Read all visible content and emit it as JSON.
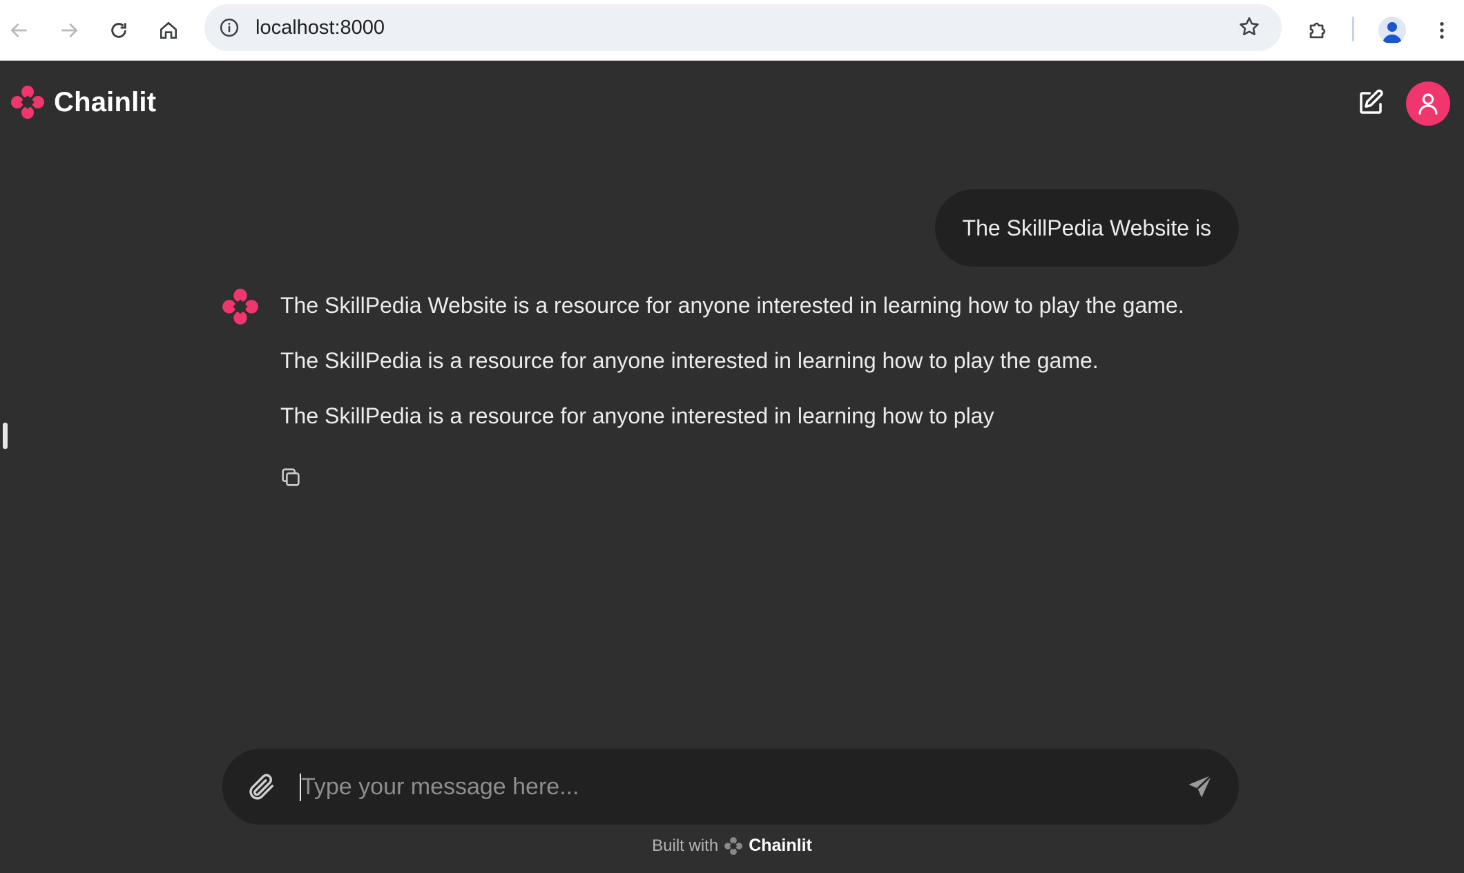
{
  "browser": {
    "url": "localhost:8000"
  },
  "app": {
    "name": "Chainlit",
    "brand_color": "#f0366d"
  },
  "conversation": {
    "user_message": "The SkillPedia Website is",
    "assistant_lines": [
      "The SkillPedia Website is a resource for anyone interested in learning how to play the game.",
      "The SkillPedia is a resource for anyone interested in learning how to play the game.",
      "The SkillPedia is a resource for anyone interested in learning how to play"
    ]
  },
  "composer": {
    "placeholder": "Type your message here...",
    "value": ""
  },
  "footer": {
    "built_with": "Built with",
    "brand": "Chainlit"
  },
  "icons": [
    "back-icon",
    "forward-icon",
    "reload-icon",
    "home-icon",
    "site-info-icon",
    "bookmark-star-icon",
    "extensions-icon",
    "profile-icon",
    "kebab-menu-icon",
    "chainlit-logo-icon",
    "new-chat-icon",
    "user-avatar-icon",
    "copy-icon",
    "paperclip-icon",
    "send-icon"
  ]
}
